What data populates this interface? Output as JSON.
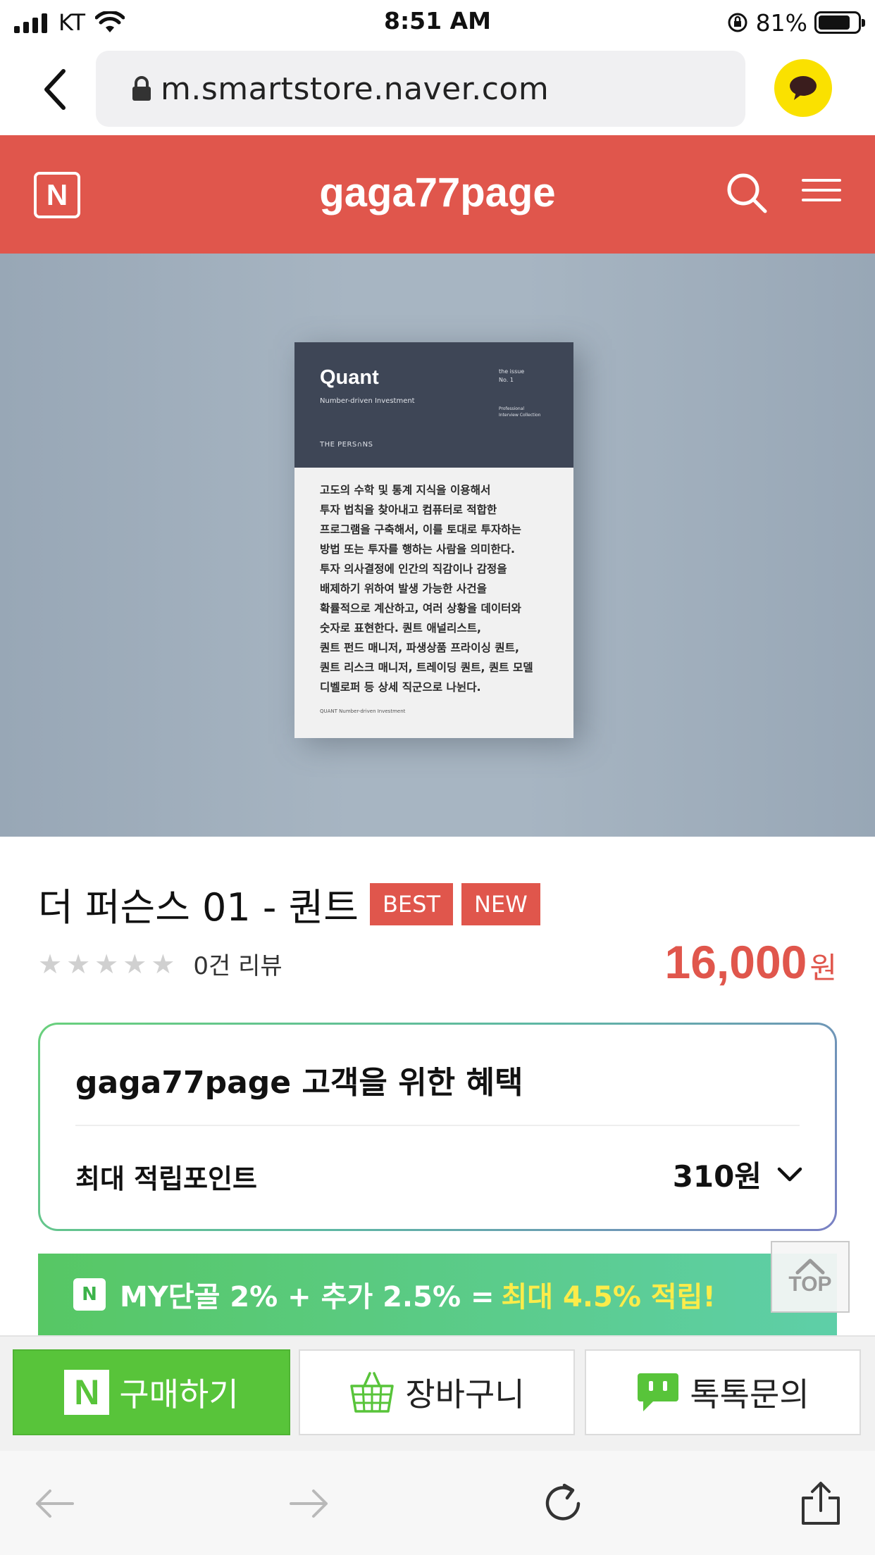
{
  "status_bar": {
    "carrier": "KT",
    "time": "8:51 AM",
    "battery": "81%",
    "battery_level": 0.81
  },
  "browser": {
    "url": "m.smartstore.naver.com"
  },
  "store": {
    "logo_letter": "N",
    "name": "gaga77page"
  },
  "book_cover": {
    "title": "Quant",
    "subtitle": "Number-driven Investment",
    "issue": "the issue\nNo. 1",
    "collection": "Professional\nInterview Collection",
    "publisher": "THE PERS∩NS",
    "body": "고도의 수학 및 통계 지식을 이용해서\n투자 법칙을 찾아내고 컴퓨터로 적합한\n프로그램을 구축해서, 이를 토대로 투자하는\n방법 또는 투자를 행하는 사람을 의미한다.\n투자 의사결정에 인간의 직감이나 감정을\n배제하기 위하여 발생 가능한 사건을\n확률적으로 계산하고, 여러 상황을 데이터와\n숫자로 표현한다. 퀀트 애널리스트,\n퀀트 펀드 매니저, 파생상품 프라이싱 퀀트,\n퀀트 리스크 매니저, 트레이딩 퀀트, 퀀트 모델\n디벨로퍼 등 상세 직군으로 나뉜다.",
    "footer": "QUANT  Number-driven Investment"
  },
  "product": {
    "title": "더 퍼슨스 01 - 퀀트",
    "badges": [
      "BEST",
      "NEW"
    ],
    "rating": 0,
    "review_count": "0건 리뷰",
    "price": "16,000",
    "price_unit": "원"
  },
  "benefit": {
    "title": "gaga77page 고객을 위한 혜택",
    "points_label": "최대 적립포인트",
    "points_value": "310원"
  },
  "promo": {
    "text": "MY단골 2% + 추가 2.5% =",
    "highlight": "최대 4.5% 적립!"
  },
  "top_button": {
    "label": "TOP"
  },
  "actions": {
    "buy": "구매하기",
    "cart": "장바구니",
    "talk": "톡톡문의"
  },
  "colors": {
    "brand": "#e0564c",
    "naver_green": "#58c43a",
    "promo_highlight": "#fcec4a"
  }
}
